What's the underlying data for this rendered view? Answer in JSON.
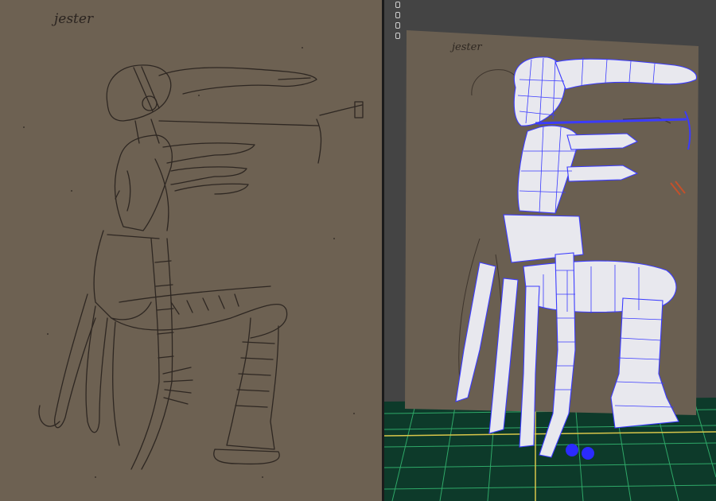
{
  "reference_panel": {
    "sketch_label": "jester"
  },
  "viewport": {
    "sketch_label": "jester",
    "mesh_color": "#3b3bff",
    "grid_color": "#2fa868",
    "ground_color": "#0d3a2a",
    "axis_color": "#d8c64a",
    "toolbar_icons": [
      "viewport-dot-icon",
      "viewport-dot-icon",
      "viewport-dot-icon",
      "viewport-dot-icon"
    ]
  },
  "colors": {
    "paper": "#6d6152",
    "viewport_bg": "#444444"
  }
}
